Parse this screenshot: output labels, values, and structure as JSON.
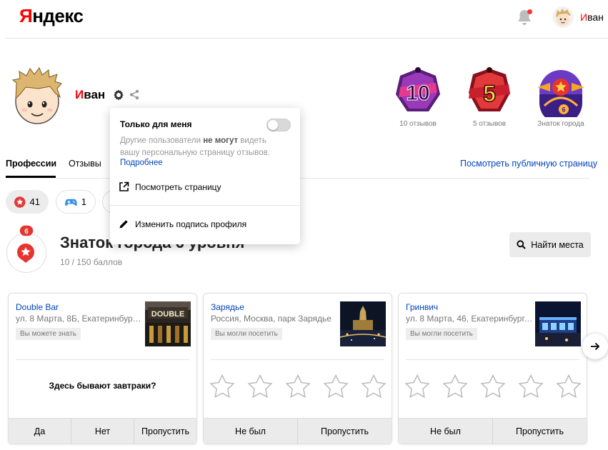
{
  "header": {
    "logo_first": "Я",
    "logo_rest": "ндекс",
    "user_first": "И",
    "user_rest": "ван"
  },
  "profile": {
    "name_first": "И",
    "name_rest": "ван"
  },
  "badges": [
    {
      "number": "10",
      "label": "10 отзывов"
    },
    {
      "number": "5",
      "label": "5 отзывов"
    },
    {
      "number": "6",
      "label": "Знаток города"
    }
  ],
  "tabs": {
    "active": "Профессии",
    "second": "Отзывы",
    "public_link": "Посмотреть публичную страницу"
  },
  "chips": [
    {
      "count": "41",
      "icon": "star-icon"
    },
    {
      "count": "1",
      "icon": "gamepad-icon"
    }
  ],
  "level": {
    "badge_num": "6",
    "title": "Знаток города 6 уровня",
    "subtitle": "10 / 150 баллов",
    "find_button": "Найти места"
  },
  "cards": [
    {
      "title": "Double Bar",
      "address": "ул. 8 Марта, 8Б, Екатеринбург,...",
      "tag": "Вы можете знать",
      "question": "Здесь бывают завтраки?",
      "buttons": [
        "Да",
        "Нет",
        "Пропустить"
      ]
    },
    {
      "title": "Зарядье",
      "address": "Россия, Москва, парк Зарядье",
      "tag": "Вы могли посетить",
      "buttons": [
        "Не был",
        "Пропустить"
      ]
    },
    {
      "title": "Гринвич",
      "address": "ул. 8 Марта, 46, Екатеринбург,...",
      "tag": "Вы могли посетить",
      "buttons": [
        "Не был",
        "Пропустить"
      ]
    }
  ],
  "popup": {
    "title": "Только для меня",
    "desc_before": "Другие пользователи ",
    "desc_bold": "не могут",
    "desc_after": " видеть вашу персональную страницу отзывов.",
    "more": "Подробнее",
    "view_page": "Посмотреть страницу",
    "edit_signature": "Изменить подпись профиля",
    "toggle_on": false
  },
  "colors": {
    "brand_red": "#ff0000",
    "link_blue": "#0044bb"
  }
}
